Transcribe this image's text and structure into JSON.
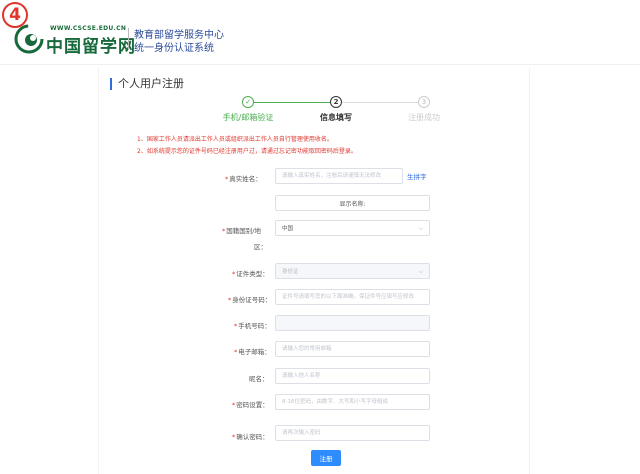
{
  "badge": "4",
  "logo": {
    "url": "WWW.CSCSE.EDU.CN",
    "name": "中国留学网"
  },
  "header": {
    "line1": "教育部留学服务中心",
    "line2": "统一身份认证系统"
  },
  "page": {
    "title": "个人用户注册"
  },
  "steps": [
    {
      "index": "✓",
      "label": "手机/邮箱验证",
      "state": "done"
    },
    {
      "index": "2",
      "label": "信息填写",
      "state": "active"
    },
    {
      "index": "3",
      "label": "注册成功",
      "state": "todo"
    }
  ],
  "notices": [
    "1、国家工作人员请派出工作人员或组织派出工作人员自行管理使用收名。",
    "2、如系统提示您的证件号码已经注册用户过，请通过忘记密功能取回密码后登录。"
  ],
  "form": {
    "real_name": {
      "label": "真实姓名：",
      "placeholder": "请输入真实姓名，注册后请谨慎无法修改"
    },
    "generate_link": "生拼字",
    "display_name": "显示名称:",
    "country": {
      "label1": "国籍国别/地",
      "label2": "区：",
      "value": "中国"
    },
    "id_type": {
      "label": "证件类型：",
      "value": "身份证"
    },
    "id_number": {
      "label": "身份证号码：",
      "placeholder": "证件号请填写您的以下面准确，保证件号应填写应修改"
    },
    "phone": {
      "label": "手机号码：",
      "placeholder": ""
    },
    "email": {
      "label": "电子邮箱：",
      "placeholder": "请输入您的常用邮箱"
    },
    "nickname": {
      "label": "昵名：",
      "placeholder": "请输入他人名称"
    },
    "password": {
      "label": "密码设置：",
      "placeholder": "8-16位密码，由数字、大写和小写字母组成"
    },
    "confirm_password": {
      "label": "确认密码：",
      "placeholder": "请再次输入密码"
    }
  },
  "submit_label": "注册",
  "colors": {
    "accent": "#2f8cff",
    "success": "#4caf50",
    "warning": "#e0352b",
    "brand": "#17683a"
  }
}
